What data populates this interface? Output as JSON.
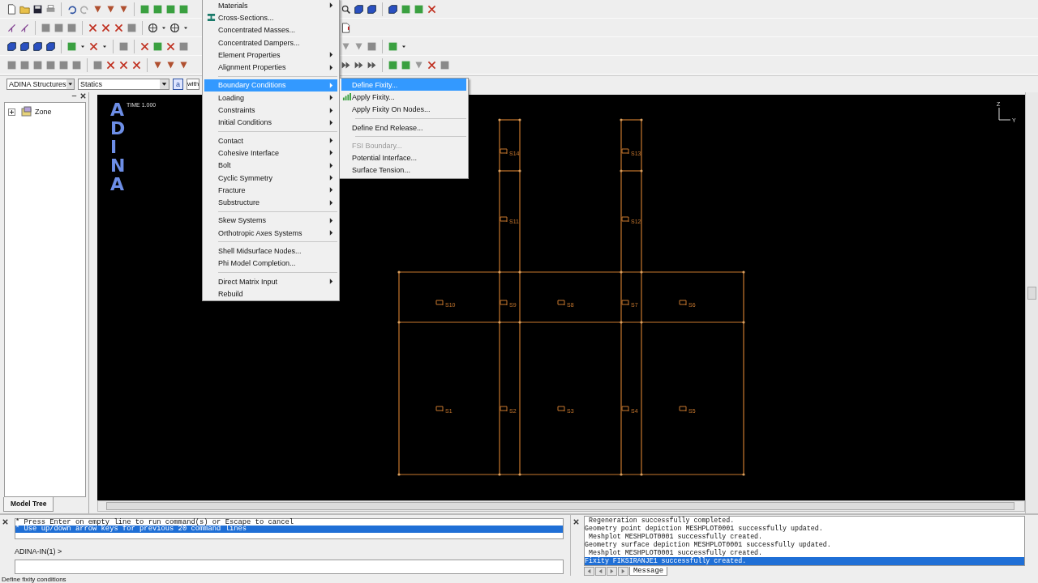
{
  "selectors": [
    {
      "value": "ADINA Structures"
    },
    {
      "value": "Statics"
    }
  ],
  "mode_button": {
    "label": "a"
  },
  "partial_field": {
    "value": "with"
  },
  "main_menu": {
    "items": [
      {
        "kind": "item",
        "label": "Materials",
        "submenu": true,
        "selected": false
      },
      {
        "kind": "ibeam",
        "label": "Cross-Sections...",
        "submenu": false,
        "selected": false
      },
      {
        "kind": "item",
        "label": "Concentrated Masses...",
        "submenu": false,
        "selected": false
      },
      {
        "kind": "item",
        "label": "Concentrated Dampers...",
        "submenu": false,
        "selected": false
      },
      {
        "kind": "item",
        "label": "Element Properties",
        "submenu": true,
        "selected": false
      },
      {
        "kind": "item",
        "label": "Alignment Properties",
        "submenu": true,
        "selected": false
      },
      {
        "kind": "separator"
      },
      {
        "kind": "item",
        "label": "Boundary Conditions",
        "submenu": true,
        "selected": true
      },
      {
        "kind": "item",
        "label": "Loading",
        "submenu": true,
        "selected": false
      },
      {
        "kind": "item",
        "label": "Constraints",
        "submenu": true,
        "selected": false
      },
      {
        "kind": "item",
        "label": "Initial Conditions",
        "submenu": true,
        "selected": false
      },
      {
        "kind": "separator"
      },
      {
        "kind": "item",
        "label": "Contact",
        "submenu": true,
        "selected": false
      },
      {
        "kind": "item",
        "label": "Cohesive Interface",
        "submenu": true,
        "selected": false
      },
      {
        "kind": "item",
        "label": "Bolt",
        "submenu": true,
        "selected": false
      },
      {
        "kind": "item",
        "label": "Cyclic Symmetry",
        "submenu": true,
        "selected": false
      },
      {
        "kind": "item",
        "label": "Fracture",
        "submenu": true,
        "selected": false
      },
      {
        "kind": "item",
        "label": "Substructure",
        "submenu": true,
        "selected": false
      },
      {
        "kind": "separator"
      },
      {
        "kind": "item",
        "label": "Skew Systems",
        "submenu": true,
        "selected": false
      },
      {
        "kind": "item",
        "label": "Orthotropic Axes Systems",
        "submenu": true,
        "selected": false
      },
      {
        "kind": "separator"
      },
      {
        "kind": "item",
        "label": "Shell Midsurface Nodes...",
        "submenu": false,
        "selected": false
      },
      {
        "kind": "item",
        "label": "Phi Model Completion...",
        "submenu": false,
        "selected": false
      },
      {
        "kind": "separator"
      },
      {
        "kind": "item",
        "label": "Direct Matrix Input",
        "submenu": true,
        "selected": false
      },
      {
        "kind": "item",
        "label": "Rebuild",
        "submenu": false,
        "selected": false
      }
    ]
  },
  "sub_menu": {
    "items": [
      {
        "kind": "item",
        "label": "Define Fixity...",
        "selected": true,
        "disabled": false
      },
      {
        "kind": "bars",
        "label": "Apply Fixity...",
        "selected": false,
        "disabled": false
      },
      {
        "kind": "item",
        "label": "Apply Fixity On Nodes...",
        "selected": false,
        "disabled": false
      },
      {
        "kind": "separator"
      },
      {
        "kind": "item",
        "label": "Define End Release...",
        "selected": false,
        "disabled": false
      },
      {
        "kind": "separator"
      },
      {
        "kind": "item",
        "label": "FSI Boundary...",
        "selected": false,
        "disabled": true
      },
      {
        "kind": "item",
        "label": "Potential Interface...",
        "selected": false,
        "disabled": false
      },
      {
        "kind": "item",
        "label": "Surface Tension...",
        "selected": false,
        "disabled": false
      }
    ]
  },
  "tree": [
    {
      "label": "Zone",
      "expanded": false
    }
  ],
  "left_tab": {
    "label": "Model Tree"
  },
  "viewport": {
    "logo": "ADINA",
    "time": "TIME 1.000",
    "axis_labels": [
      "Z",
      "Y"
    ],
    "labels": [
      {
        "text": "S14"
      },
      {
        "text": "S13"
      },
      {
        "text": "S11"
      },
      {
        "text": "S12"
      },
      {
        "text": "S10"
      },
      {
        "text": "S9"
      },
      {
        "text": "S8"
      },
      {
        "text": "S7"
      },
      {
        "text": "S6"
      },
      {
        "text": "S1"
      },
      {
        "text": "S2"
      },
      {
        "text": "S3"
      },
      {
        "text": "S4"
      },
      {
        "text": "S5"
      }
    ]
  },
  "command": {
    "lines": [
      {
        "text": "* Press Enter on empty line to run command(s) or Escape to cancel",
        "selected": false
      },
      {
        "text": "* Use up/down arrow keys for previous 20 command lines",
        "selected": true
      }
    ],
    "prompt": "ADINA-IN(1) >"
  },
  "messages": {
    "lines": [
      {
        "text": " Regeneration successfully completed.",
        "selected": false
      },
      {
        "text": "Geometry point depiction MESHPLOT0001 successfully updated.",
        "selected": false
      },
      {
        "text": " Meshplot MESHPLOT0001 successfully created.",
        "selected": false
      },
      {
        "text": "Geometry surface depiction MESHPLOT0001 successfully updated.",
        "selected": false
      },
      {
        "text": " Meshplot MESHPLOT0001 successfully created.",
        "selected": false
      },
      {
        "text": "Fixity FIKSIRANJE1 successfully created.",
        "selected": true
      }
    ],
    "tab": "Message"
  },
  "status_bar": {
    "text": "Define fixity conditions"
  }
}
